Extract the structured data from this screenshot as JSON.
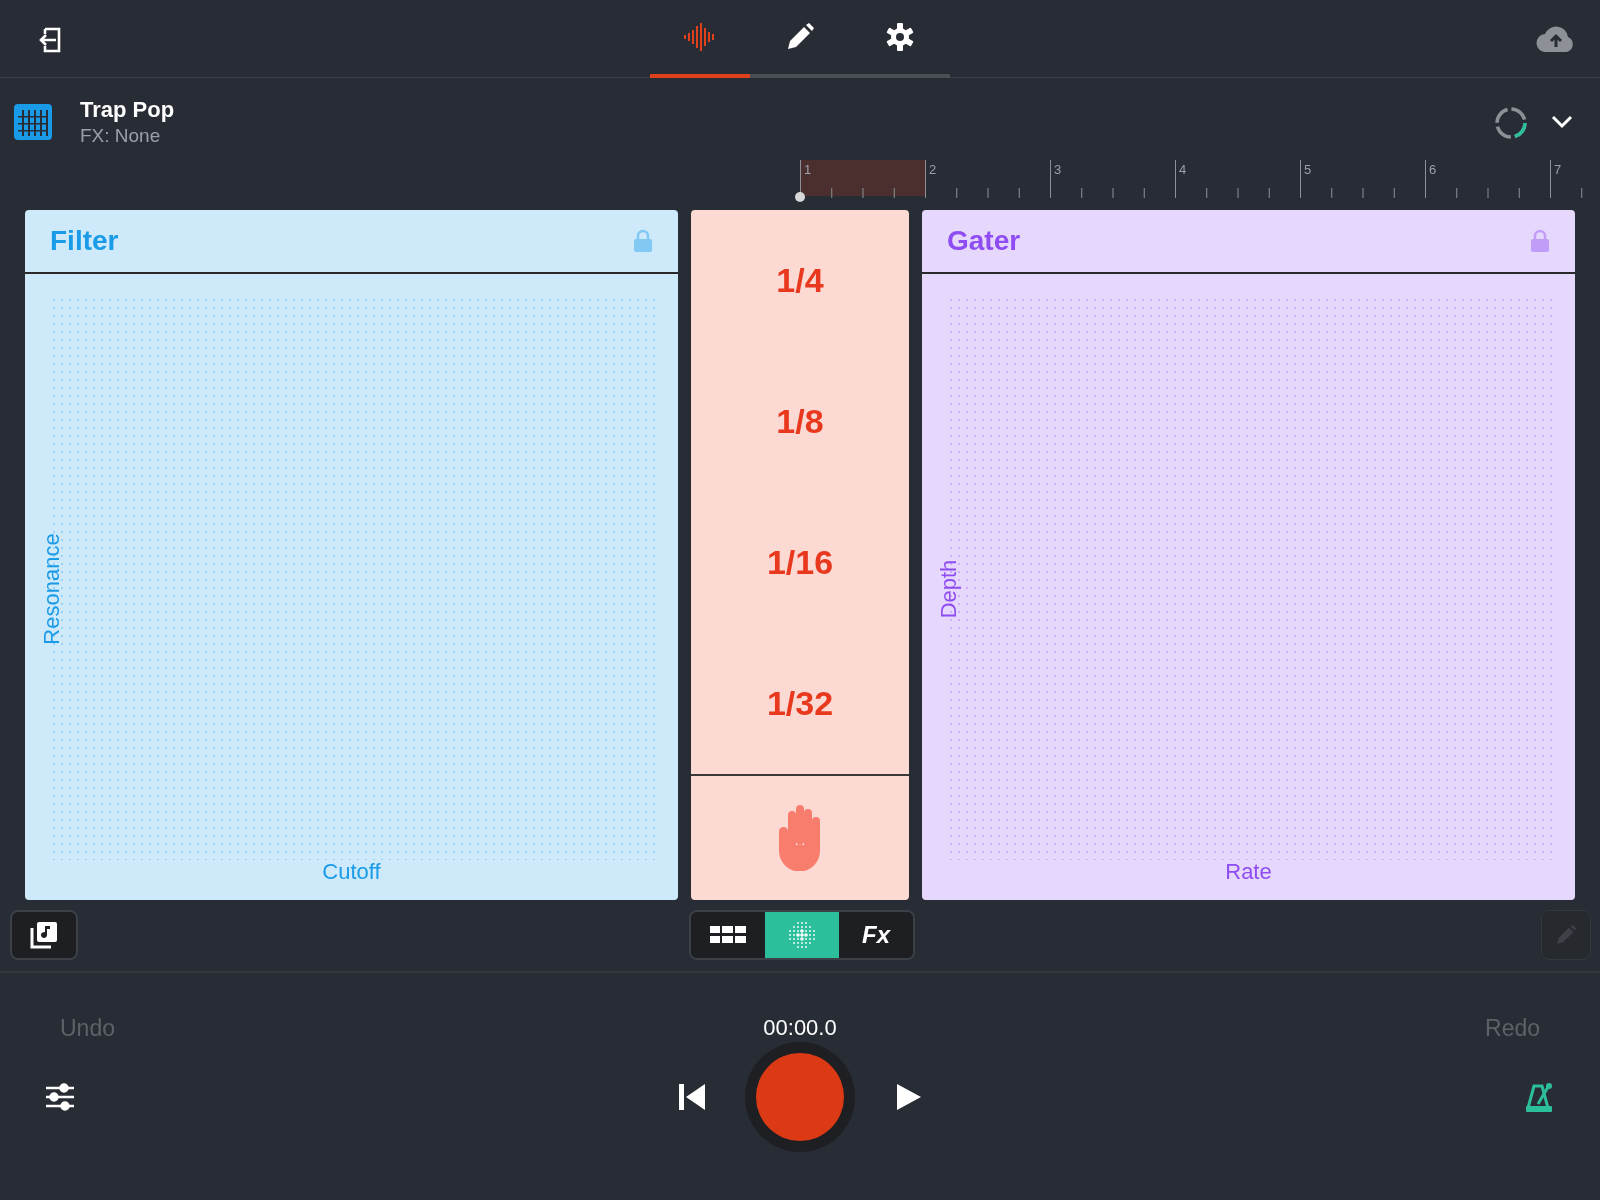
{
  "tabs": [
    {
      "kind": "waveform",
      "selected": true
    },
    {
      "kind": "pencil",
      "selected": false
    },
    {
      "kind": "gear",
      "selected": false
    }
  ],
  "track": {
    "name": "Trap Pop",
    "fx": "FX: None"
  },
  "ruler": {
    "bars": [
      "1",
      "2",
      "3",
      "4",
      "5",
      "6",
      "7"
    ]
  },
  "pads": [
    {
      "title": "Filter",
      "x_label": "Cutoff",
      "y_label": "Resonance",
      "color": "#1a9be8"
    },
    {
      "title": "Gater",
      "x_label": "Rate",
      "y_label": "Depth",
      "color": "#8e4cf2"
    }
  ],
  "rates": [
    "1/4",
    "1/8",
    "1/16",
    "1/32"
  ],
  "modes": [
    {
      "kind": "grid",
      "selected": false
    },
    {
      "kind": "dots",
      "selected": true
    },
    {
      "kind": "text",
      "label": "Fx",
      "selected": false
    }
  ],
  "edit_button": {
    "disabled": true
  },
  "undo": {
    "label": "Undo",
    "disabled": true
  },
  "redo": {
    "label": "Redo",
    "disabled": true
  },
  "time": "00:00.0"
}
